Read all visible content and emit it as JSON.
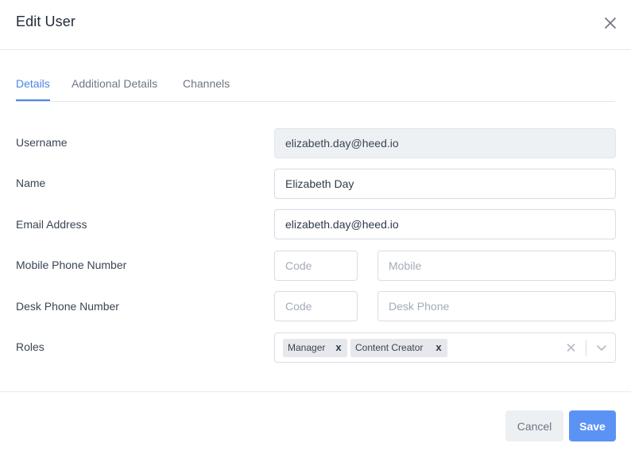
{
  "dialog": {
    "title": "Edit User"
  },
  "tabs": [
    {
      "label": "Details",
      "active": true
    },
    {
      "label": "Additional Details",
      "active": false
    },
    {
      "label": "Channels",
      "active": false
    }
  ],
  "form": {
    "username": {
      "label": "Username",
      "value": "elizabeth.day@heed.io"
    },
    "name": {
      "label": "Name",
      "value": "Elizabeth Day"
    },
    "email": {
      "label": "Email Address",
      "value": "elizabeth.day@heed.io"
    },
    "mobile": {
      "label": "Mobile Phone Number",
      "code_placeholder": "Code",
      "number_placeholder": "Mobile"
    },
    "desk": {
      "label": "Desk Phone Number",
      "code_placeholder": "Code",
      "number_placeholder": "Desk Phone"
    },
    "roles": {
      "label": "Roles",
      "selected": [
        "Manager",
        "Content Creator"
      ],
      "remove_glyph": "x"
    }
  },
  "footer": {
    "cancel_label": "Cancel",
    "save_label": "Save"
  },
  "colors": {
    "accent": "#4a86e8",
    "save_button": "#5b93f5",
    "cancel_button": "#edf0f3",
    "readonly_field": "#eef1f4"
  },
  "icons": {
    "close": "close-icon",
    "clear": "clear-icon",
    "dropdown": "chevron-down-icon"
  }
}
